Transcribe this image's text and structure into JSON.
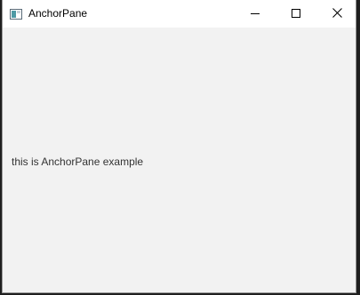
{
  "window": {
    "title": "AnchorPane",
    "controls": {
      "minimize_icon": "minimize-icon",
      "maximize_icon": "maximize-icon",
      "close_icon": "close-icon"
    }
  },
  "content": {
    "label": "this is AnchorPane example"
  },
  "colors": {
    "titlebar": "#ffffff",
    "content_bg": "#f2f2f2",
    "text": "#333333"
  }
}
